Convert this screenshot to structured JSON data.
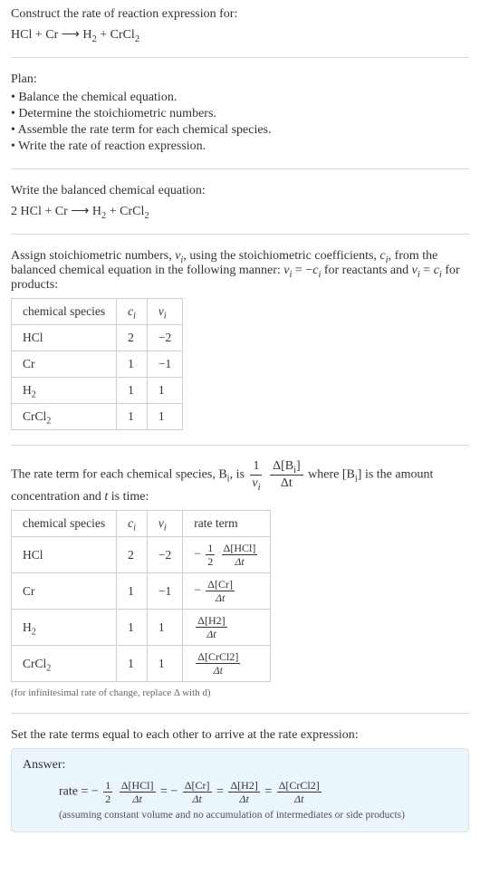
{
  "question": {
    "prompt": "Construct the rate of reaction expression for:",
    "equation_left": "HCl + Cr",
    "arrow": "⟶",
    "equation_right_h2": "H",
    "equation_right_h2_sub": "2",
    "plus": " + ",
    "equation_right_crcl2": "CrCl",
    "equation_right_crcl2_sub": "2"
  },
  "plan": {
    "label": "Plan:",
    "items": [
      "• Balance the chemical equation.",
      "• Determine the stoichiometric numbers.",
      "• Assemble the rate term for each chemical species.",
      "• Write the rate of reaction expression."
    ]
  },
  "balanced": {
    "intro": "Write the balanced chemical equation:",
    "coeff_hcl": "2 ",
    "hcl": "HCl",
    "plus1": " + ",
    "cr": "Cr",
    "arrow": " ⟶ ",
    "h2": "H",
    "h2_sub": "2",
    "plus2": " + ",
    "crcl2": "CrCl",
    "crcl2_sub": "2"
  },
  "stoich": {
    "intro_a": "Assign stoichiometric numbers, ",
    "nu_i": "ν",
    "nu_i_sub": "i",
    "intro_b": ", using the stoichiometric coefficients, ",
    "c_i": "c",
    "c_i_sub": "i",
    "intro_c": ", from the balanced chemical equation in the following manner: ",
    "eq1_lhs": "ν",
    "eq1_lhs_sub": "i",
    "eq1_mid": " = −",
    "eq1_rhs": "c",
    "eq1_rhs_sub": "i",
    "intro_d": " for reactants and ",
    "eq2_lhs": "ν",
    "eq2_lhs_sub": "i",
    "eq2_mid": " = ",
    "eq2_rhs": "c",
    "eq2_rhs_sub": "i",
    "intro_e": " for products:",
    "headers": [
      "chemical species",
      "c_i",
      "ν_i"
    ],
    "col_c": "c",
    "col_c_sub": "i",
    "col_nu": "ν",
    "col_nu_sub": "i",
    "rows": [
      {
        "name": "HCl",
        "sub": "",
        "c": "2",
        "nu": "−2"
      },
      {
        "name": "Cr",
        "sub": "",
        "c": "1",
        "nu": "−1"
      },
      {
        "name": "H",
        "sub": "2",
        "c": "1",
        "nu": "1"
      },
      {
        "name": "CrCl",
        "sub": "2",
        "c": "1",
        "nu": "1"
      }
    ]
  },
  "rate_intro": {
    "a": "The rate term for each chemical species, B",
    "a_sub": "i",
    "b": ", is ",
    "frac1_num": "1",
    "frac1_den_a": "ν",
    "frac1_den_sub": "i",
    "frac2_num_a": "Δ[B",
    "frac2_num_sub": "i",
    "frac2_num_b": "]",
    "frac2_den": "Δt",
    "c": " where [B",
    "c_sub": "i",
    "d": "] is the amount concentration and ",
    "t": "t",
    "e": " is time:"
  },
  "rate_table": {
    "headers": [
      "chemical species",
      "c_i",
      "ν_i",
      "rate term"
    ],
    "col_header_rate": "rate term",
    "rows": [
      {
        "name": "HCl",
        "sub": "",
        "c": "2",
        "nu": "−2",
        "term_prefix": "−",
        "term_frac1_num": "1",
        "term_frac1_den": "2",
        "term_delta_num": "Δ[HCl]",
        "term_delta_den": "Δt"
      },
      {
        "name": "Cr",
        "sub": "",
        "c": "1",
        "nu": "−1",
        "term_prefix": "−",
        "term_frac1_num": "",
        "term_frac1_den": "",
        "term_delta_num": "Δ[Cr]",
        "term_delta_den": "Δt"
      },
      {
        "name": "H",
        "sub": "2",
        "c": "1",
        "nu": "1",
        "term_prefix": "",
        "term_frac1_num": "",
        "term_frac1_den": "",
        "term_delta_num": "Δ[H2]",
        "term_delta_den": "Δt"
      },
      {
        "name": "CrCl",
        "sub": "2",
        "c": "1",
        "nu": "1",
        "term_prefix": "",
        "term_frac1_num": "",
        "term_frac1_den": "",
        "term_delta_num": "Δ[CrCl2]",
        "term_delta_den": "Δt"
      }
    ],
    "footnote": "(for infinitesimal rate of change, replace Δ with d)"
  },
  "set_text": "Set the rate terms equal to each other to arrive at the rate expression:",
  "answer": {
    "label": "Answer:",
    "rate_word": "rate = ",
    "neg": "−",
    "half_num": "1",
    "half_den": "2",
    "t1_num": "Δ[HCl]",
    "t1_den": "Δt",
    "eq": " = ",
    "t2_num": "Δ[Cr]",
    "t2_den": "Δt",
    "t3_num": "Δ[H2]",
    "t3_den": "Δt",
    "t4_num": "Δ[CrCl2]",
    "t4_den": "Δt",
    "note": "(assuming constant volume and no accumulation of intermediates or side products)"
  }
}
